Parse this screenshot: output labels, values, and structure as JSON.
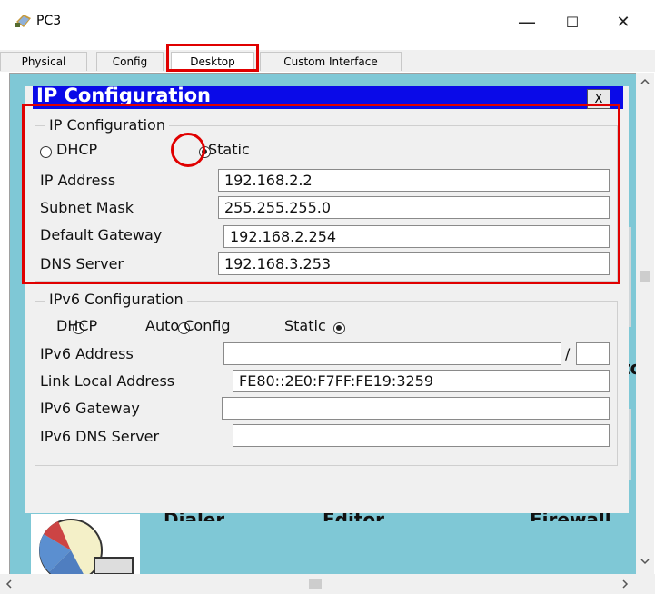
{
  "window": {
    "title": "PC3",
    "minimize_glyph": "—",
    "maximize_glyph": "☐",
    "close_glyph": "✕"
  },
  "tabs": [
    {
      "label": "Physical"
    },
    {
      "label": "Config"
    },
    {
      "label": "Desktop"
    },
    {
      "label": "Custom Interface"
    }
  ],
  "dialog": {
    "title": "IP Configuration",
    "close_label": "X"
  },
  "ipv4": {
    "group_label": "IP Configuration",
    "dhcp_label": "DHCP",
    "static_label": "Static",
    "selected": "Static",
    "ip_address_label": "IP Address",
    "ip_address_value": "192.168.2.2",
    "subnet_mask_label": "Subnet Mask",
    "subnet_mask_value": "255.255.255.0",
    "default_gateway_label": "Default Gateway",
    "default_gateway_value": "192.168.2.254",
    "dns_server_label": "DNS Server",
    "dns_server_value": "192.168.3.253"
  },
  "ipv6": {
    "group_label": "IPv6 Configuration",
    "dhcp_label": "DHCP",
    "auto_config_label": "Auto Config",
    "static_label": "Static",
    "selected": "Static",
    "address_label": "IPv6 Address",
    "address_value": "",
    "prefix_separator": "/",
    "prefix_value": "",
    "link_local_label": "Link Local Address",
    "link_local_value": "FE80::2E0:F7FF:FE19:3259",
    "gateway_label": "IPv6 Gateway",
    "gateway_value": "",
    "dns_label": "IPv6 DNS Server",
    "dns_value": ""
  },
  "background_labels": {
    "dialer": "Dialer",
    "editor": "Editor",
    "firewall": "Firewall",
    "right_fragment": "to"
  },
  "colors": {
    "desktop_bg": "#7fc8d6",
    "dialog_title_bg": "#0a0ae8",
    "highlight_red": "#e00000"
  }
}
